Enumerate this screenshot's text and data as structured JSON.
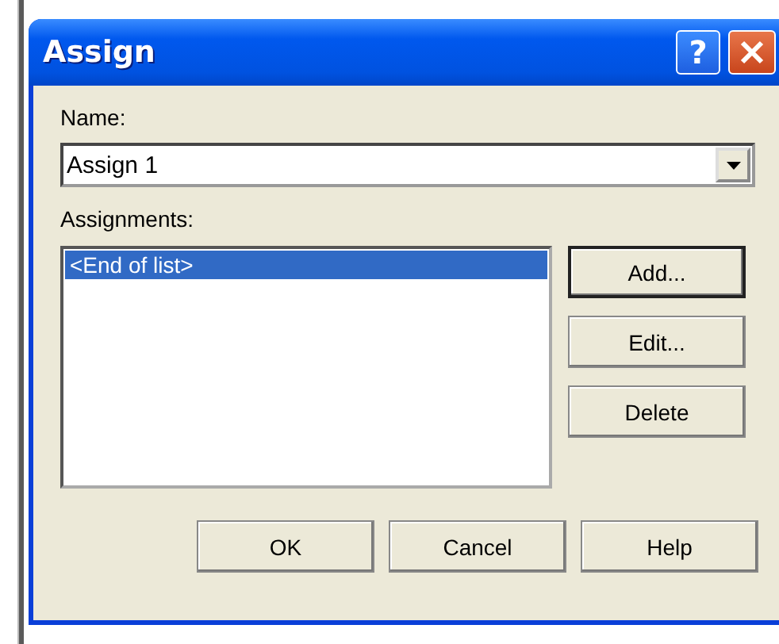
{
  "window": {
    "title": "Assign",
    "help_glyph": "?"
  },
  "name_label": "Name:",
  "name_field": {
    "value": "Assign 1"
  },
  "assignments_label": "Assignments:",
  "assignments": [
    {
      "text": "<End of list>",
      "selected": true
    }
  ],
  "side_buttons": [
    {
      "label": "Add...",
      "default": true
    },
    {
      "label": "Edit...",
      "default": false
    },
    {
      "label": "Delete",
      "default": false
    }
  ],
  "bottom_buttons": [
    "OK",
    "Cancel",
    "Help"
  ]
}
